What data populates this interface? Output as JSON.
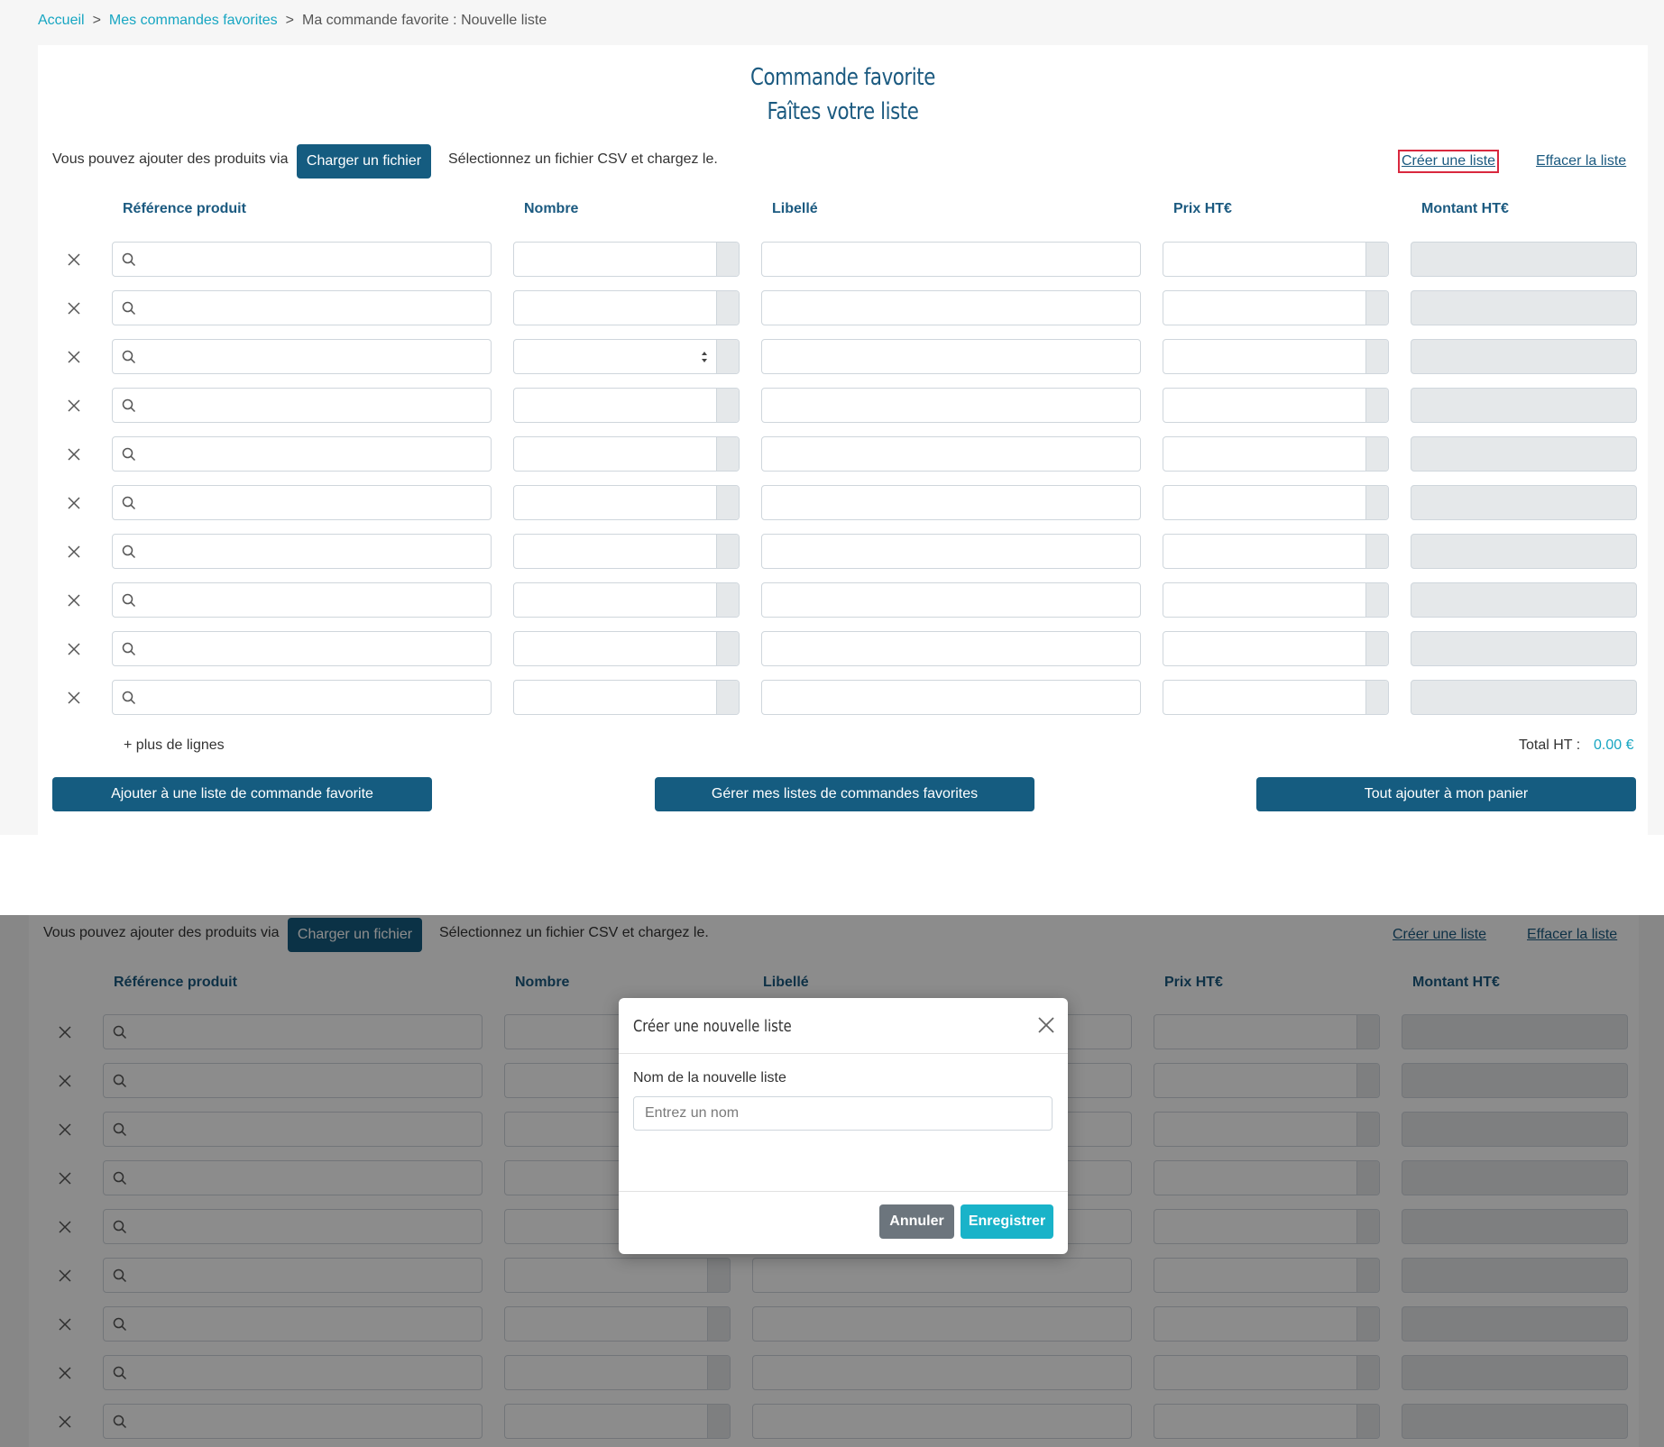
{
  "breadcrumb": {
    "items": [
      "Accueil",
      "Mes commandes favorites"
    ],
    "current": "Ma commande favorite : Nouvelle liste",
    "separator": ">"
  },
  "page": {
    "title_line1": "Commande favorite",
    "title_line2": "Faîtes votre liste"
  },
  "toolbar": {
    "intro_text": "Vous pouvez ajouter des produits via",
    "upload_button": "Charger un fichier",
    "upload_hint": "Sélectionnez un fichier CSV et chargez le.",
    "create_list_link": "Créer une liste",
    "clear_list_link": "Effacer la liste"
  },
  "table": {
    "headers": {
      "reference": "Référence produit",
      "quantity": "Nombre",
      "label": "Libellé",
      "price": "Prix HT€",
      "amount": "Montant HT€"
    },
    "row_count": 10,
    "more_rows": "+ plus de lignes",
    "total_label": "Total HT :",
    "total_value": "0.00 €"
  },
  "actions": {
    "add_to_favorite": "Ajouter à une liste de commande favorite",
    "manage_lists": "Gérer mes listes de commandes favorites",
    "add_all_to_cart": "Tout ajouter à mon panier"
  },
  "modal": {
    "title": "Créer une nouvelle liste",
    "field_label": "Nom de la nouvelle liste",
    "field_placeholder": "Entrez un nom",
    "field_value": "",
    "cancel_button": "Annuler",
    "save_button": "Enregistrer"
  },
  "colors": {
    "brand_dark": "#155c80",
    "link_accent": "#17a6c2",
    "highlight_outline": "#d9283e",
    "save_button": "#19b3c9",
    "cancel_button": "#6c757d"
  }
}
